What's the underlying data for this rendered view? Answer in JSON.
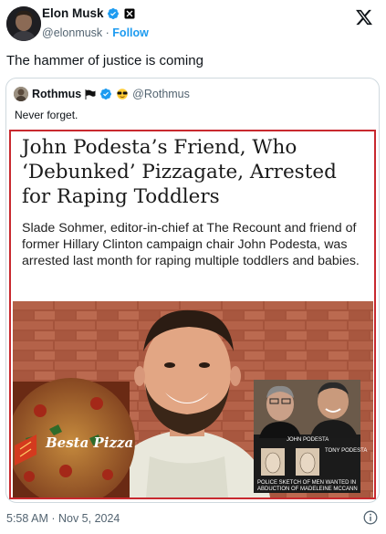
{
  "author": {
    "name": "Elon Musk",
    "handle": "@elonmusk",
    "separator": " · ",
    "follow_label": "Follow"
  },
  "tweet": {
    "text": "The hammer of justice is coming",
    "timestamp": "5:58 AM · Nov 5, 2024"
  },
  "quote": {
    "name": "Rothmus",
    "handle": "@Rothmus",
    "text": "Never forget.",
    "article": {
      "title": "John Podesta’s Friend, Who ‘Debunked’ Pizzagate, Arrested for Raping Toddlers",
      "subtitle": "Slade Sohmer, editor-in-chief at The Recount and friend of former Hillary Clinton campaign chair John Podesta, was arrested last month for raping multiple toddlers and babies.",
      "pizza_caption": "Besta Pizza",
      "label_1": "JOHN PODESTA",
      "label_2": "TONY PODESTA",
      "sketch_caption_1": "POLICE SKETCH OF MEN WANTED IN",
      "sketch_caption_2": "ABDUCTION OF MADELEINE MCCANN"
    }
  },
  "colors": {
    "verified": "#1d9bf0",
    "article_border": "#c8292f",
    "muted_text": "#536471"
  }
}
